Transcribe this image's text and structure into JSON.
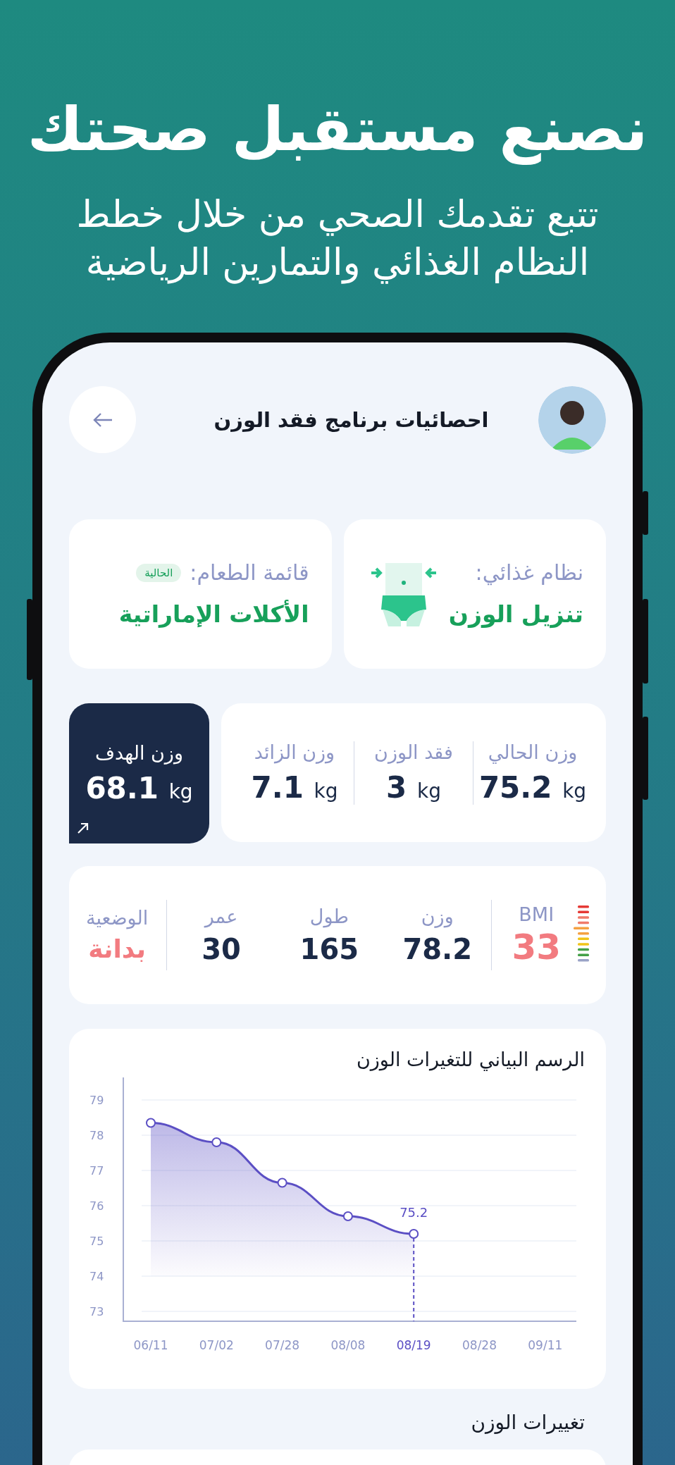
{
  "hero": {
    "title": "نصنع مستقبل صحتك",
    "subtitle_lines": [
      "تتبع تقدمك الصحي من خلال خطط",
      "النظام الغذائي والتمارين الرياضية"
    ]
  },
  "screen": {
    "title": "احصائيات برنامج فقد الوزن"
  },
  "diet_cards": [
    {
      "kind": "illustration",
      "label": "نظام غذائي:",
      "value": "تنزيل الوزن"
    },
    {
      "kind": "badge",
      "label": "قائمة الطعام:",
      "value": "الأكلات الإماراتية",
      "badge": "الحالية"
    }
  ],
  "weights": [
    {
      "label": "وزن الحالي",
      "value": "75.2",
      "unit": "kg"
    },
    {
      "label": "فقد الوزن",
      "value": "3",
      "unit": "kg"
    },
    {
      "label": "وزن الزائد",
      "value": "7.1",
      "unit": "kg"
    }
  ],
  "goal": {
    "label": "وزن الهدف",
    "value": "68.1",
    "unit": "kg"
  },
  "bmi": {
    "label": "BMI",
    "value": "33"
  },
  "body_stats": [
    {
      "label": "وزن",
      "value": "78.2"
    },
    {
      "label": "طول",
      "value": "165"
    },
    {
      "label": "عمر",
      "value": "30"
    }
  ],
  "status": {
    "label": "الوضعية",
    "value": "بدانة"
  },
  "chart": {
    "title": "الرسم البياني للتغيرات الوزن",
    "chart_data": {
      "type": "area",
      "categories": [
        "06/11",
        "07/02",
        "07/28",
        "08/08",
        "08/19",
        "08/28",
        "09/11"
      ],
      "series": [
        {
          "color": "#5b4fc4",
          "values": [
            78.35,
            77.8,
            76.65,
            75.7,
            75.2,
            null,
            null
          ]
        }
      ],
      "ylim": [
        73,
        79
      ],
      "yticks": [
        73,
        74,
        75,
        76,
        77,
        78,
        79
      ],
      "grid": true,
      "ref_lines": [
        {
          "axis": "x",
          "value": "08/19",
          "color": "#5b4fc4"
        }
      ],
      "annotations": [
        {
          "x": "08/19",
          "y": 75.2,
          "text": "75.2"
        }
      ]
    }
  },
  "section_title": "تغييرات الوزن"
}
